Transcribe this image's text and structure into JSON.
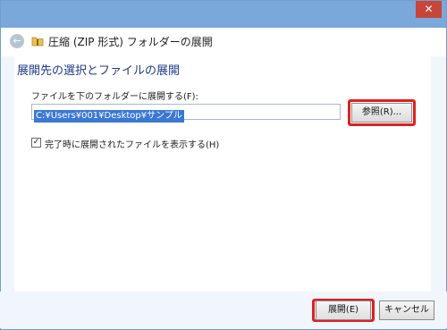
{
  "window": {
    "title": "圧縮 (ZIP 形式) フォルダーの展開",
    "close_glyph": "✕",
    "back_glyph": "←"
  },
  "main": {
    "heading": "展開先の選択とファイルの展開",
    "field_label": "ファイルを下のフォルダーに展開する(F):",
    "path_value": "C:¥Users¥001¥Desktop¥サンプル",
    "browse_label": "参照(R)...",
    "checkbox_label": "完了時に展開されたファイルを表示する(H)",
    "checkbox_checked": true,
    "check_glyph": "✓"
  },
  "footer": {
    "extract_label": "展開(E)",
    "cancel_label": "キャンセル"
  },
  "colors": {
    "titlebar": "#7aa8da",
    "highlight": "#e02020",
    "heading": "#1e3a8a",
    "selection": "#3a78d4"
  },
  "icons": {
    "back": "back-arrow-icon",
    "folder": "zip-folder-icon",
    "close": "close-icon",
    "check": "checkmark-icon"
  }
}
